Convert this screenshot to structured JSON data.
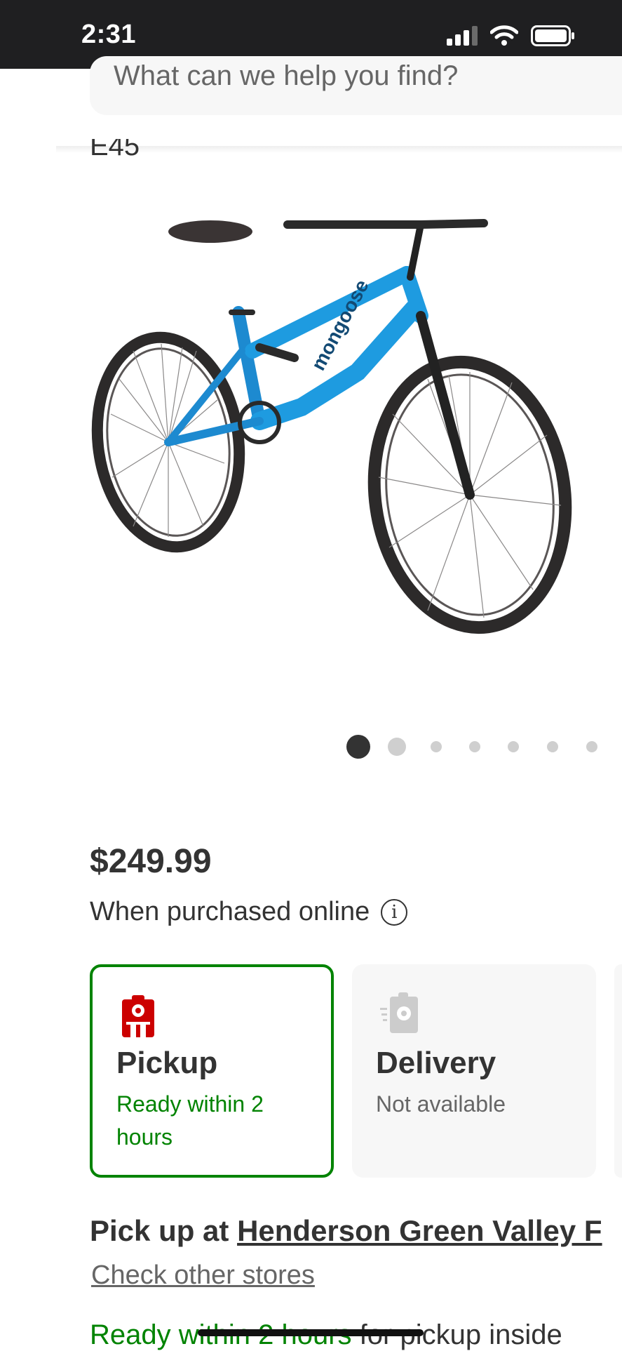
{
  "status_bar": {
    "time": "2:31",
    "icons": [
      "signal-icon",
      "wifi-icon",
      "battery-icon"
    ]
  },
  "search": {
    "placeholder": "What can we help you find?"
  },
  "product": {
    "title_fragment": "E45",
    "image_subject": "blue full-suspension mountain bike",
    "carousel": {
      "total": 7,
      "active_index": 0
    },
    "price": "$249.99",
    "price_note": "When purchased online"
  },
  "fulfillment": {
    "pickup": {
      "title": "Pickup",
      "status": "Ready within 2 hours",
      "selected": true
    },
    "delivery": {
      "title": "Delivery",
      "status": "Not available",
      "selected": false
    }
  },
  "store": {
    "prefix": "Pick up at ",
    "name": "Henderson Green Valley F",
    "check_other": "Check other stores",
    "ready_green": "Ready within 2 hours",
    "ready_rest": " for pickup inside"
  },
  "colors": {
    "brand_red": "#cc0000",
    "success_green": "#008300",
    "text": "#333333",
    "muted": "#666666"
  }
}
